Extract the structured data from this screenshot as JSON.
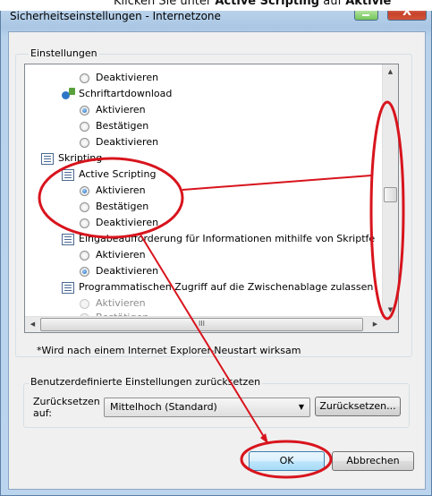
{
  "caption": {
    "prefix": "Klicken Sie unter",
    "bold1": "Active Scripting",
    "middle": "auf",
    "bold2": "Aktivie"
  },
  "window": {
    "title": "Sicherheitseinstellungen - Internetzone",
    "close_glyph": "X"
  },
  "settings_group": {
    "label": "Einstellungen"
  },
  "tree": {
    "r0": "Deaktivieren",
    "r1": "Schriftartdownload",
    "r2": "Aktivieren",
    "r3": "Bestätigen",
    "r4": "Deaktivieren",
    "r5": "Skripting",
    "r6": "Active Scripting",
    "r7": "Aktivieren",
    "r8": "Bestätigen",
    "r9": "Deaktivieren",
    "r10": "Eingabeaufforderung für Informationen mithilfe von Skriptfe",
    "r11": "Aktivieren",
    "r12": "Deaktivieren",
    "r13": "Programmatischen Zugriff auf die Zwischenablage zulassen",
    "r14": "Aktivieren",
    "r15": "Bestätigen"
  },
  "hscroll": {
    "thumb_glyph": "III"
  },
  "restart_note": "*Wird nach einem Internet Explorer-Neustart wirksam",
  "reset_group": {
    "label": "Benutzerdefinierte Einstellungen zurücksetzen",
    "field_label_1": "Zurücksetzen",
    "field_label_2": "auf:",
    "selected_level": "Mittelhoch (Standard)",
    "reset_button": "Zurücksetzen..."
  },
  "buttons": {
    "ok": "OK",
    "cancel": "Abbrechen"
  },
  "colors": {
    "annotation": "#d8141d",
    "titlebar": "#b8d2ec",
    "ok_button": "#bee6fd"
  }
}
